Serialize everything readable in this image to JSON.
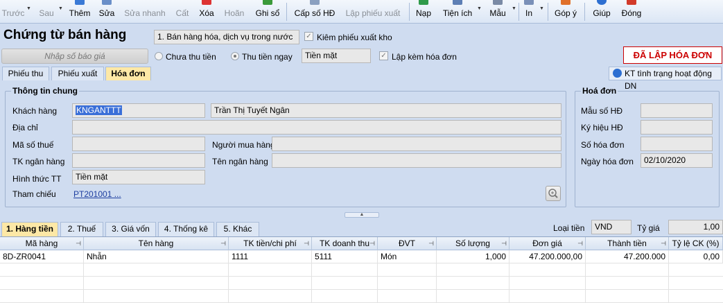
{
  "toolbar": {
    "prev": "Trước",
    "next": "Sau",
    "add": "Thêm",
    "edit": "Sửa",
    "quick_edit": "Sửa nhanh",
    "save": "Cất",
    "delete": "Xóa",
    "undo": "Hoãn",
    "post": "Ghi sổ",
    "issue_invoice_no": "Cấp số HĐ",
    "create_export_slip": "Lập phiếu xuất",
    "load": "Nạp",
    "utilities": "Tiện ích",
    "template": "Mẫu",
    "print": "In",
    "feedback": "Góp ý",
    "help": "Giúp",
    "close": "Đóng"
  },
  "header": {
    "title": "Chứng từ bán hàng",
    "sale_type": "1. Bán hàng hóa, dịch vụ trong nước",
    "check_export": "Kiêm phiếu xuất kho",
    "quote_placeholder": "Nhập số báo giá",
    "unpaid": "Chưa thu tiền",
    "paid_now": "Thu tiền ngay",
    "payment_method": "Tiền mặt",
    "with_invoice": "Lập kèm hóa đơn",
    "invoice_status": "ĐÃ LẬP HÓA ĐƠN",
    "kt_status": "KT tình trạng hoạt động DN"
  },
  "tabs": [
    "Phiếu thu",
    "Phiếu xuất",
    "Hóa đơn"
  ],
  "general": {
    "legend": "Thông tin chung",
    "customer_label": "Khách hàng",
    "customer_code": "KNGANTTT",
    "customer_name": "Trần Thị Tuyết Ngân",
    "address_label": "Địa chỉ",
    "tax_label": "Mã số thuế",
    "buyer_label": "Người mua hàng",
    "bank_acc_label": "TK ngân hàng",
    "bank_name_label": "Tên ngân hàng",
    "pay_form_label": "Hình thức TT",
    "pay_form": "Tiền mặt",
    "ref_label": "Tham chiếu",
    "ref_value": "PT201001 ..."
  },
  "invoice": {
    "legend": "Hoá đơn",
    "form_no_label": "Mẫu số HĐ",
    "symbol_label": "Ký hiệu HĐ",
    "invoice_no_label": "Số hóa đơn",
    "date_label": "Ngày hóa đơn",
    "date": "02/10/2020"
  },
  "bottom_tabs": [
    "1. Hàng tiền",
    "2. Thuế",
    "3. Giá vốn",
    "4. Thống kê",
    "5. Khác"
  ],
  "currency": {
    "label": "Loại tiền",
    "value": "VND",
    "rate_label": "Tỷ giá",
    "rate": "1,00"
  },
  "grid": {
    "columns": [
      "Mã hàng",
      "Tên hàng",
      "TK tiền/chi phí",
      "TK doanh thu",
      "ĐVT",
      "Số lượng",
      "Đơn giá",
      "Thành tiền",
      "Tỷ lệ CK (%)"
    ],
    "rows": [
      [
        "8D-ZR0041",
        "Nhẫn",
        "1111",
        "5111",
        "Món",
        "1,000",
        "47.200.000,00",
        "47.200.000",
        "0,00"
      ]
    ]
  },
  "colors": {
    "accent": "#cc0000",
    "active_tab": "#fde8a6",
    "background": "#cfdcf0"
  }
}
